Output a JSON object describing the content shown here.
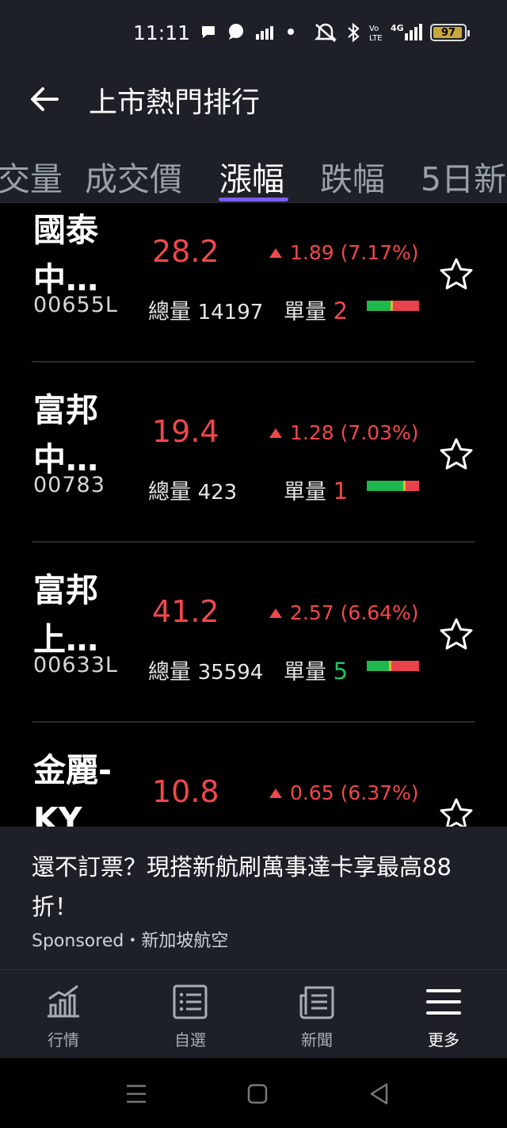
{
  "status_bar": {
    "time": "11:11",
    "battery": "97"
  },
  "header": {
    "title": "上市熱門排行"
  },
  "tabs": [
    {
      "label": "成交量"
    },
    {
      "label": "成交價"
    },
    {
      "label": "漲幅"
    },
    {
      "label": "跌幅"
    },
    {
      "label": "5日新"
    }
  ],
  "stocks": [
    {
      "name": "國泰中…",
      "code": "00655L",
      "price": "28.2",
      "change": "1.89 (7.17%)",
      "volume_label": "總量",
      "volume": "14197",
      "unit_label": "單量",
      "unit": "2",
      "unit_color": "red",
      "buy_ratio": 0.45
    },
    {
      "name": "富邦中…",
      "code": "00783",
      "price": "19.4",
      "change": "1.28 (7.03%)",
      "volume_label": "總量",
      "volume": "423",
      "unit_label": "單量",
      "unit": "1",
      "unit_color": "red",
      "buy_ratio": 0.7
    },
    {
      "name": "富邦上…",
      "code": "00633L",
      "price": "41.2",
      "change": "2.57 (6.64%)",
      "volume_label": "總量",
      "volume": "35594",
      "unit_label": "單量",
      "unit": "5",
      "unit_color": "green",
      "buy_ratio": 0.42
    },
    {
      "name": "金麗-KY",
      "code": "",
      "price": "10.8",
      "change": "0.65 (6.37%)"
    }
  ],
  "ad": {
    "title": "還不訂票？現搭新航刷萬事達卡享最高88折！",
    "sponsor": "Sponsored・新加坡航空"
  },
  "bottom_nav": [
    {
      "label": "行情",
      "icon": "chart-icon"
    },
    {
      "label": "自選",
      "icon": "watchlist-icon"
    },
    {
      "label": "新聞",
      "icon": "news-icon"
    },
    {
      "label": "更多",
      "icon": "menu-icon"
    }
  ],
  "colors": {
    "up": "#f0484a",
    "down": "#1fc55b",
    "accent": "#7b5cf0",
    "surface": "#1d2027"
  }
}
